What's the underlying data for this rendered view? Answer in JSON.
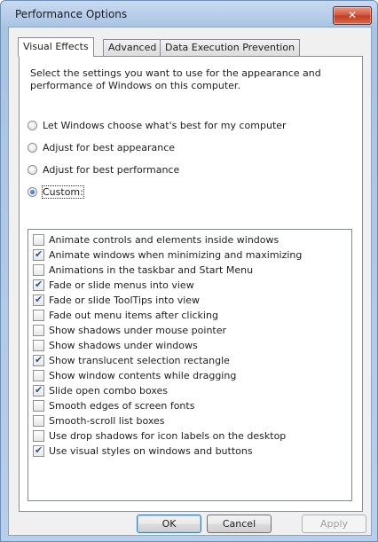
{
  "window": {
    "title": "Performance Options",
    "close_glyph": "✕"
  },
  "tabs": [
    {
      "label": "Visual Effects",
      "active": true
    },
    {
      "label": "Advanced",
      "active": false
    },
    {
      "label": "Data Execution Prevention",
      "active": false
    }
  ],
  "intro_text": "Select the settings you want to use for the appearance and performance of Windows on this computer.",
  "radio_options": [
    {
      "label": "Let Windows choose what's best for my computer",
      "selected": false
    },
    {
      "label": "Adjust for best appearance",
      "selected": false
    },
    {
      "label": "Adjust for best performance",
      "selected": false
    },
    {
      "label": "Custom:",
      "selected": true
    }
  ],
  "effects": [
    {
      "label": "Animate controls and elements inside windows",
      "checked": false
    },
    {
      "label": "Animate windows when minimizing and maximizing",
      "checked": true
    },
    {
      "label": "Animations in the taskbar and Start Menu",
      "checked": false
    },
    {
      "label": "Fade or slide menus into view",
      "checked": true
    },
    {
      "label": "Fade or slide ToolTips into view",
      "checked": true
    },
    {
      "label": "Fade out menu items after clicking",
      "checked": false
    },
    {
      "label": "Show shadows under mouse pointer",
      "checked": false
    },
    {
      "label": "Show shadows under windows",
      "checked": false
    },
    {
      "label": "Show translucent selection rectangle",
      "checked": true
    },
    {
      "label": "Show window contents while dragging",
      "checked": false
    },
    {
      "label": "Slide open combo boxes",
      "checked": true
    },
    {
      "label": "Smooth edges of screen fonts",
      "checked": false
    },
    {
      "label": "Smooth-scroll list boxes",
      "checked": false
    },
    {
      "label": "Use drop shadows for icon labels on the desktop",
      "checked": false
    },
    {
      "label": "Use visual styles on windows and buttons",
      "checked": true
    }
  ],
  "buttons": {
    "ok": "OK",
    "cancel": "Cancel",
    "apply": "Apply"
  }
}
